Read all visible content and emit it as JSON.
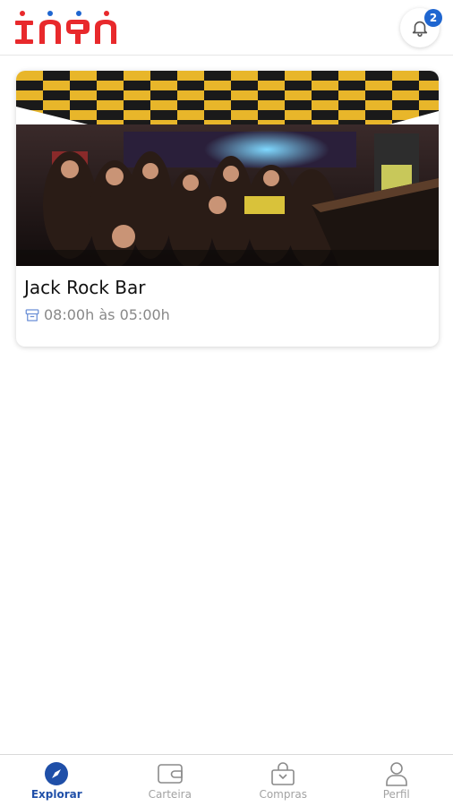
{
  "header": {
    "logo_text": "ingpn",
    "notification_count": "2"
  },
  "venue_card": {
    "name": "Jack Rock Bar",
    "hours": "08:00h às 05:00h",
    "image_description": "crowded bar interior"
  },
  "bottom_nav": {
    "items": [
      {
        "label": "Explorar",
        "icon": "compass-icon",
        "active": true
      },
      {
        "label": "Carteira",
        "icon": "wallet-icon",
        "active": false
      },
      {
        "label": "Compras",
        "icon": "shopping-bag-icon",
        "active": false
      },
      {
        "label": "Perfil",
        "icon": "user-icon",
        "active": false
      }
    ]
  },
  "colors": {
    "brand_red": "#e8292c",
    "accent_blue": "#1f66d0",
    "active_nav": "#1f4fa8",
    "inactive_nav": "#a3a3a3"
  }
}
